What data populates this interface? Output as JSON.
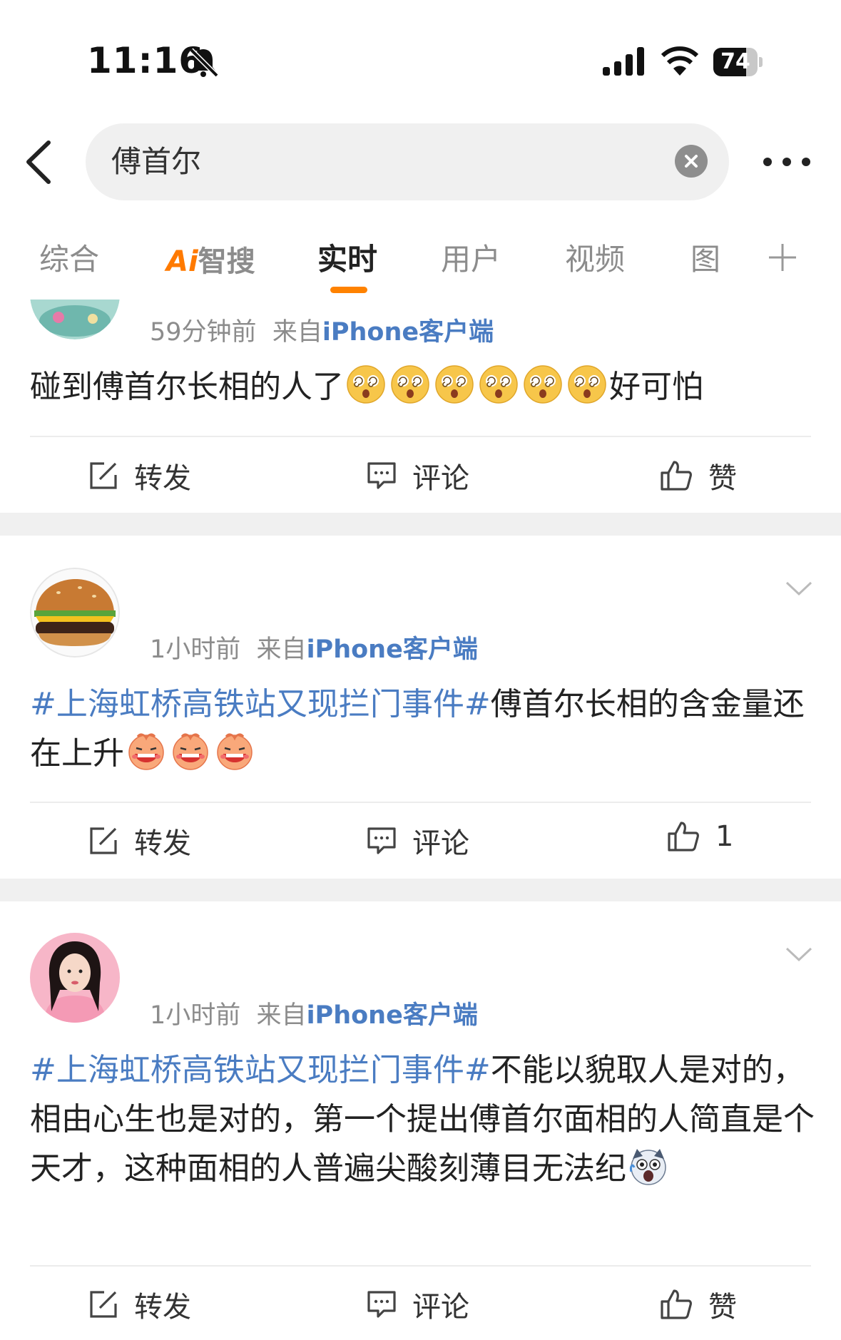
{
  "status_bar": {
    "time": "11:16",
    "battery_level": "74",
    "battery_fraction": 0.74
  },
  "search": {
    "query": "傅首尔"
  },
  "tabs": [
    {
      "label": "综合",
      "active": false
    },
    {
      "label": "Ai智搜",
      "ai_prefix": "Ai",
      "ai_rest": "智搜",
      "active": false
    },
    {
      "label": "实时",
      "active": true
    },
    {
      "label": "用户",
      "active": false
    },
    {
      "label": "视频",
      "active": false
    },
    {
      "label": "图",
      "active": false
    }
  ],
  "colors": {
    "accent": "#ff8200",
    "link": "#4a7cc2",
    "muted": "#8c8c8c"
  },
  "posts": [
    {
      "time": "59分钟前",
      "source_prefix": "来自",
      "source": "iPhone客户端",
      "text": "碰到傅首尔长相的人了",
      "emojis": [
        "dizzy-face-icon",
        "dizzy-face-icon",
        "dizzy-face-icon",
        "dizzy-face-icon",
        "dizzy-face-icon",
        "dizzy-face-icon"
      ],
      "text_after": "好可怕",
      "repost": "转发",
      "comment": "评论",
      "like": "赞"
    },
    {
      "time": "1小时前",
      "source_prefix": "来自",
      "source": "iPhone客户端",
      "hashtag": "#上海虹桥高铁站又现拦门事件#",
      "text": "傅首尔长相的含金量还在上升",
      "emojis": [
        "laughing-face-icon",
        "laughing-face-icon",
        "laughing-face-icon"
      ],
      "repost": "转发",
      "comment": "评论",
      "like": "1"
    },
    {
      "time": "1小时前",
      "source_prefix": "来自",
      "source": "iPhone客户端",
      "hashtag": "#上海虹桥高铁站又现拦门事件#",
      "text": "不能以貌取人是对的，相由心生也是对的，第一个提出傅首尔面相的人简直是个天才，这种面相的人普遍尖酸刻薄目无法纪",
      "emojis": [
        "shocked-dog-icon"
      ],
      "repost": "转发",
      "comment": "评论",
      "like": "赞"
    }
  ]
}
